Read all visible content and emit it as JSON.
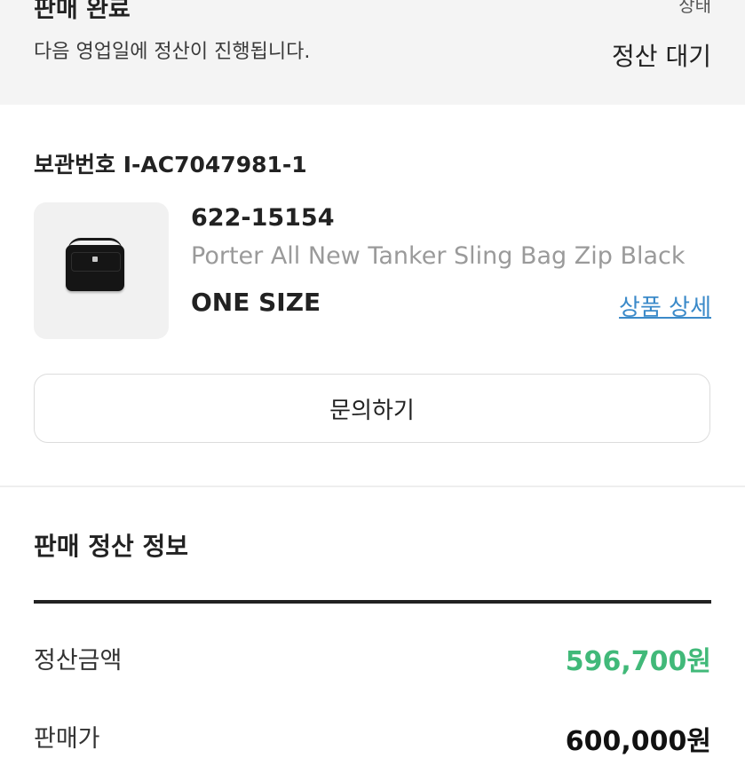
{
  "status": {
    "title": "판매 완료",
    "description": "다음 영업일에 정산이 진행됩니다.",
    "label": "상태",
    "value": "정산 대기"
  },
  "storage": {
    "label": "보관번호",
    "number": "I-AC7047981-1"
  },
  "product": {
    "model_number": "622-15154",
    "name": "Porter All New Tanker Sling Bag Zip Black",
    "size": "ONE SIZE",
    "detail_link": "상품 상세",
    "image_icon": "bag-image"
  },
  "inquiry_button": "문의하기",
  "settlement": {
    "title": "판매 정산 정보",
    "rows": [
      {
        "label": "정산금액",
        "value": "596,700원"
      },
      {
        "label": "판매가",
        "value": "600,000원"
      }
    ]
  },
  "colors": {
    "settlement_amount": "#41b979",
    "link": "#3b8ac9"
  }
}
